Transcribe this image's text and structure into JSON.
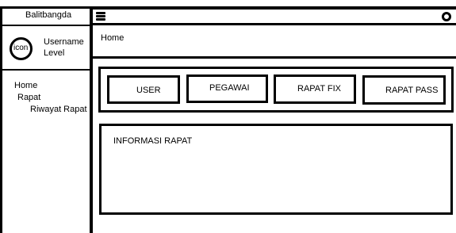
{
  "app": {
    "title": "Balitbangda"
  },
  "sidebar": {
    "avatar_label": "icon",
    "username": "Username",
    "level": "Level",
    "menu": [
      {
        "label": "Home"
      },
      {
        "label": "Rapat"
      },
      {
        "label": "Riwayat Rapat"
      }
    ]
  },
  "header": {
    "menu_icon": "hamburger-icon",
    "right_icon": "circle-icon"
  },
  "breadcrumb": {
    "label": "Home"
  },
  "nav_buttons": [
    {
      "label": "USER"
    },
    {
      "label": "PEGAWAI"
    },
    {
      "label": "RAPAT FIX"
    },
    {
      "label": "RAPAT PASS"
    }
  ],
  "info_panel": {
    "title": "INFORMASI RAPAT"
  }
}
